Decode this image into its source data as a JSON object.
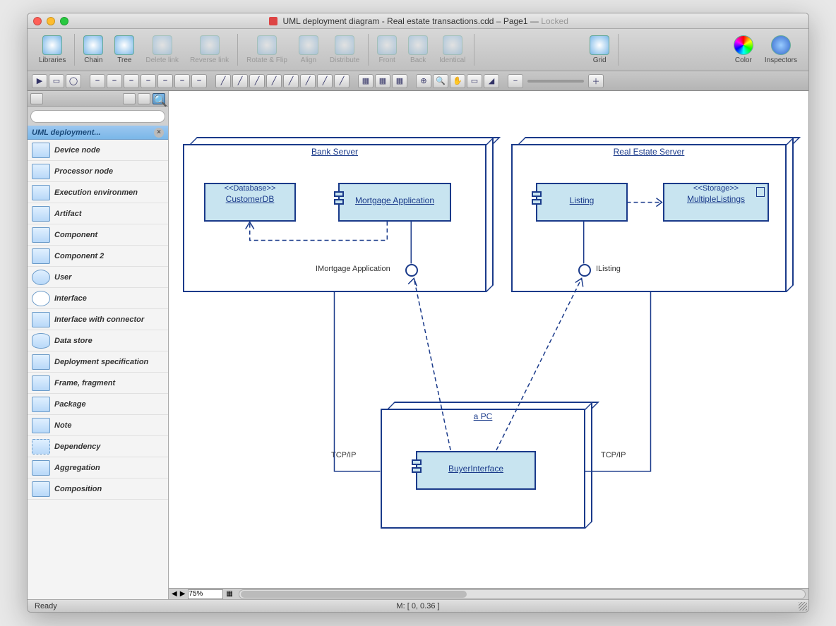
{
  "window": {
    "filename": "UML deployment diagram - Real estate transactions.cdd",
    "page": "Page1",
    "locked": "Locked"
  },
  "toolbar": {
    "libraries": "Libraries",
    "chain": "Chain",
    "tree": "Tree",
    "delete_link": "Delete link",
    "reverse_link": "Reverse link",
    "rotate_flip": "Rotate & Flip",
    "align": "Align",
    "distribute": "Distribute",
    "front": "Front",
    "back": "Back",
    "identical": "Identical",
    "grid": "Grid",
    "color": "Color",
    "inspectors": "Inspectors"
  },
  "sidebar": {
    "header": "UML deployment...",
    "search_placeholder": "",
    "items": [
      {
        "label": "Device node"
      },
      {
        "label": "Processor node"
      },
      {
        "label": "Execution environmen"
      },
      {
        "label": "Artifact"
      },
      {
        "label": "Component"
      },
      {
        "label": "Component 2"
      },
      {
        "label": "User"
      },
      {
        "label": "Interface"
      },
      {
        "label": "Interface with connector"
      },
      {
        "label": "Data store"
      },
      {
        "label": "Deployment specification"
      },
      {
        "label": "Frame, fragment"
      },
      {
        "label": "Package"
      },
      {
        "label": "Note"
      },
      {
        "label": "Dependency"
      },
      {
        "label": "Aggregation"
      },
      {
        "label": "Composition"
      }
    ]
  },
  "diagram": {
    "nodes": {
      "bank": {
        "title": "Bank Server"
      },
      "estate": {
        "title": "Real Estate Server"
      },
      "pc": {
        "title": "a PC"
      }
    },
    "components": {
      "customerdb": {
        "stereo": "<<Database>>",
        "name": "CustomerDB"
      },
      "mortgage": {
        "name": "Mortgage Application"
      },
      "listing": {
        "name": "Listing"
      },
      "multlist": {
        "stereo": "<<Storage>>",
        "name": "MultipleListings"
      },
      "buyer": {
        "name": "BuyerInterface"
      }
    },
    "interfaces": {
      "imortgage": "IMortgage Application",
      "ilisting": "IListing"
    },
    "labels": {
      "tcpip_left": "TCP/IP",
      "tcpip_right": "TCP/IP"
    }
  },
  "bottombar": {
    "zoom": "75%"
  },
  "status": {
    "ready": "Ready",
    "coords": "M: [ 0, 0.36 ]"
  }
}
